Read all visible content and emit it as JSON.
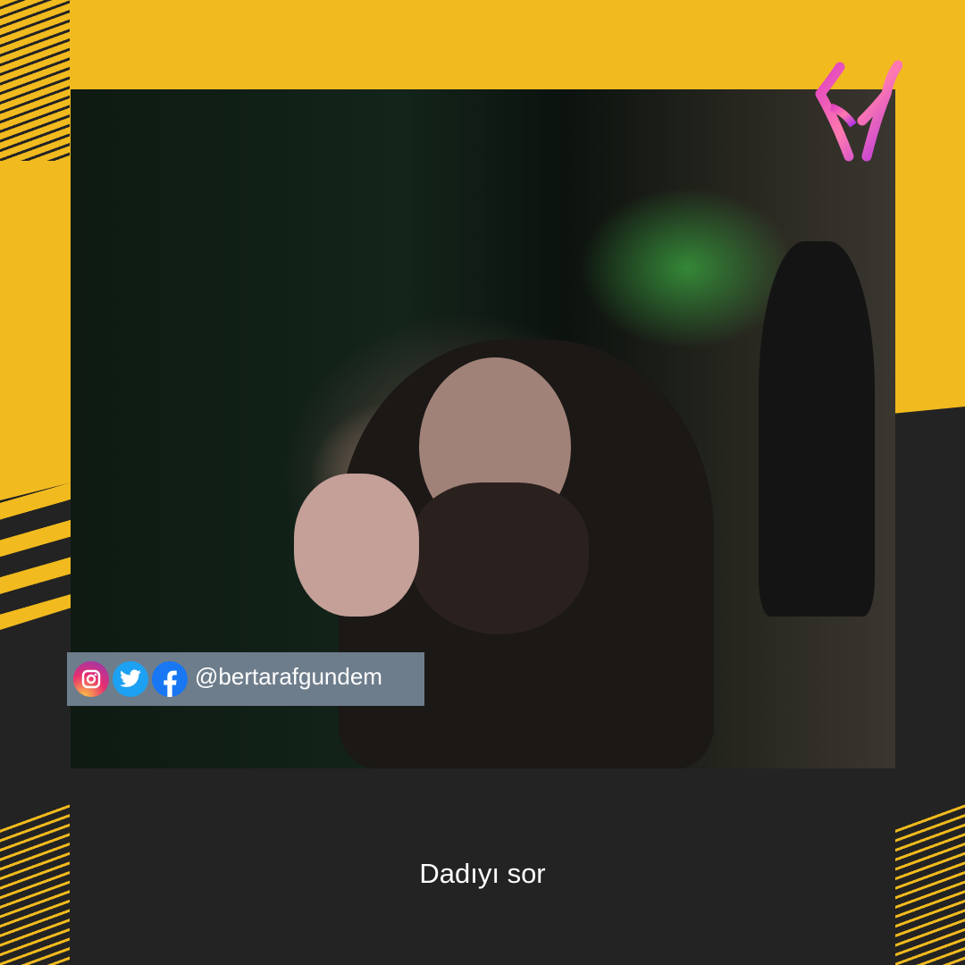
{
  "social": {
    "handle": "@bertarafgundem",
    "icons": [
      "instagram-icon",
      "twitter-icon",
      "facebook-icon"
    ]
  },
  "caption": "Dadıyı sor",
  "colors": {
    "accent": "#f1ba1e",
    "dark": "#232323",
    "social_bar": "#6e7d8c"
  }
}
